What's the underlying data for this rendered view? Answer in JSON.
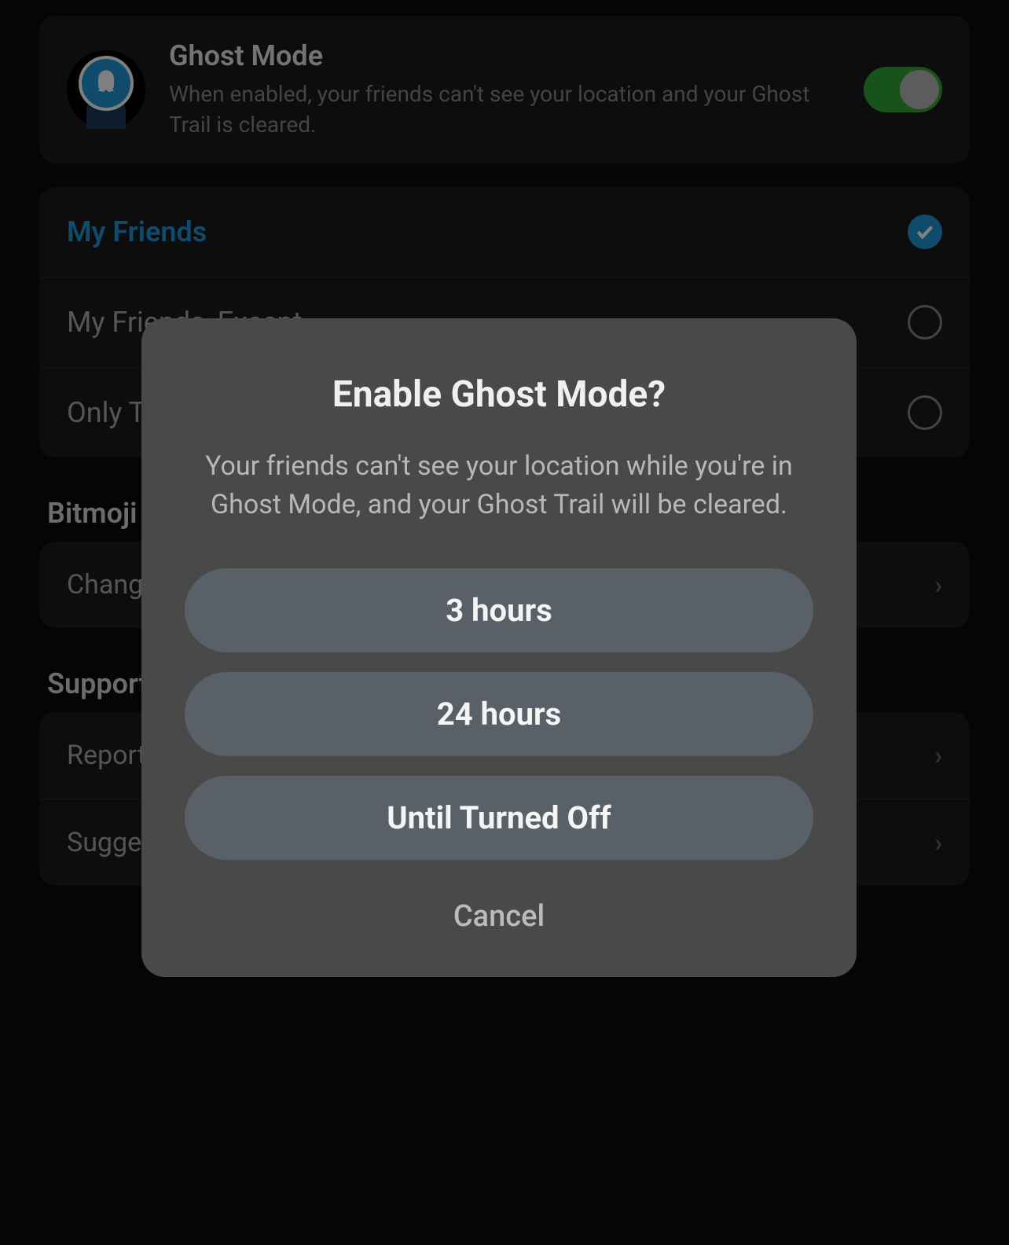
{
  "ghost_mode": {
    "title": "Ghost Mode",
    "description": "When enabled, your friends can't see your location and your Ghost Trail is cleared.",
    "enabled": true
  },
  "visibility_options": [
    {
      "label": "My Friends",
      "selected": true
    },
    {
      "label": "My Friends, Except…",
      "selected": false
    },
    {
      "label": "Only These Friends…",
      "selected": false
    }
  ],
  "sections": [
    {
      "header": "Bitmoji",
      "items": [
        {
          "label": "Change Outfit"
        }
      ]
    },
    {
      "header": "Support",
      "items": [
        {
          "label": "Report a Problem"
        },
        {
          "label": "Suggest an Improvement"
        }
      ]
    }
  ],
  "modal": {
    "title": "Enable Ghost Mode?",
    "description": "Your friends can't see your location while you're in Ghost Mode, and your Ghost Trail will be cleared.",
    "options": [
      "3 hours",
      "24 hours",
      "Until Turned Off"
    ],
    "cancel": "Cancel"
  }
}
